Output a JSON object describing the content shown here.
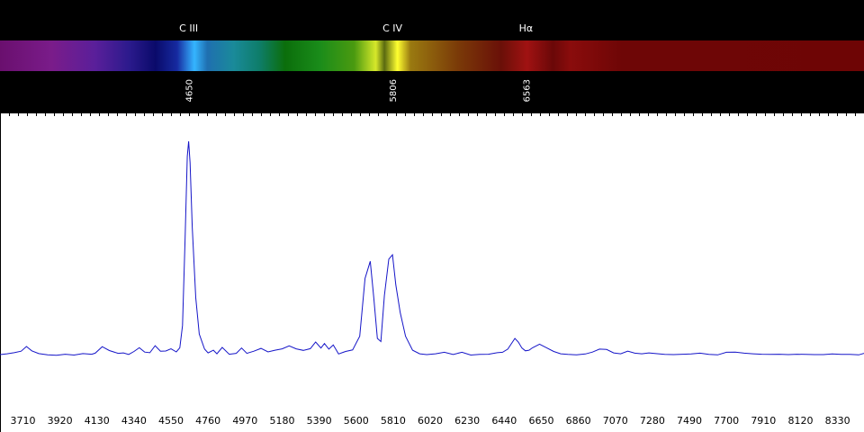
{
  "chart_data": {
    "type": "line",
    "xlabel": "",
    "ylabel": "",
    "xlim": [
      3580,
      8480
    ],
    "ylim": [
      0,
      100
    ],
    "x_ticks": [
      3710,
      3920,
      4130,
      4340,
      4550,
      4760,
      4970,
      5180,
      5390,
      5600,
      5810,
      6020,
      6230,
      6440,
      6650,
      6860,
      7070,
      7280,
      7490,
      7700,
      7910,
      8120,
      8330
    ],
    "line_color": "#1515c8",
    "lines": [
      {
        "name": "C III",
        "wavelength": "4650"
      },
      {
        "name": "C IV",
        "wavelength": "5806"
      },
      {
        "name": "Hα",
        "wavelength": "6563"
      }
    ],
    "series": [
      {
        "x": [
          3580,
          3620,
          3660,
          3700,
          3730,
          3760,
          3800,
          3850,
          3900,
          3950,
          4000,
          4050,
          4100,
          4120,
          4160,
          4200,
          4250,
          4280,
          4310,
          4340,
          4370,
          4400,
          4430,
          4460,
          4490,
          4520,
          4550,
          4580,
          4600,
          4615,
          4630,
          4642,
          4650,
          4658,
          4670,
          4690,
          4710,
          4740,
          4760,
          4790,
          4810,
          4840,
          4880,
          4920,
          4950,
          4980,
          5020,
          5060,
          5100,
          5140,
          5180,
          5220,
          5260,
          5300,
          5340,
          5370,
          5400,
          5420,
          5445,
          5470,
          5500,
          5540,
          5580,
          5620,
          5650,
          5680,
          5700,
          5720,
          5740,
          5760,
          5785,
          5806,
          5825,
          5850,
          5880,
          5920,
          5960,
          6000,
          6050,
          6100,
          6150,
          6200,
          6250,
          6300,
          6350,
          6400,
          6430,
          6460,
          6480,
          6500,
          6520,
          6540,
          6560,
          6580,
          6600,
          6640,
          6680,
          6720,
          6760,
          6800,
          6850,
          6900,
          6940,
          6980,
          7020,
          7060,
          7100,
          7140,
          7180,
          7220,
          7260,
          7300,
          7350,
          7400,
          7450,
          7500,
          7550,
          7600,
          7650,
          7700,
          7750,
          7800,
          7850,
          7900,
          7950,
          8000,
          8050,
          8100,
          8150,
          8200,
          8250,
          8300,
          8350,
          8400,
          8450,
          8480
        ],
        "y": [
          0.4,
          0.8,
          1.3,
          2.0,
          4.2,
          2.2,
          0.9,
          0.3,
          0.1,
          0.6,
          0.2,
          0.9,
          0.6,
          1.1,
          4.1,
          2.3,
          1.0,
          1.2,
          0.5,
          1.9,
          3.6,
          1.6,
          1.3,
          4.6,
          2.0,
          2.1,
          3.1,
          1.7,
          3.6,
          14.0,
          55.0,
          93.0,
          100.0,
          90.0,
          60.0,
          27.0,
          10.0,
          3.0,
          1.2,
          2.5,
          0.8,
          3.8,
          0.6,
          1.0,
          3.5,
          1.0,
          2.0,
          3.3,
          1.7,
          2.5,
          3.1,
          4.5,
          3.1,
          2.4,
          3.2,
          6.3,
          3.5,
          5.6,
          3.0,
          4.9,
          0.7,
          1.9,
          2.6,
          9.0,
          36.0,
          44.0,
          27.0,
          8.0,
          6.5,
          28.0,
          45.0,
          47.0,
          33.0,
          20.0,
          9.0,
          2.5,
          0.8,
          0.4,
          0.8,
          1.5,
          0.5,
          1.5,
          0.2,
          0.5,
          0.6,
          1.3,
          1.5,
          3.0,
          5.5,
          8.0,
          6.2,
          3.5,
          2.2,
          2.5,
          3.6,
          5.3,
          3.6,
          1.9,
          0.8,
          0.5,
          0.3,
          0.7,
          1.6,
          3.0,
          2.8,
          1.2,
          0.8,
          2.0,
          1.1,
          0.8,
          1.2,
          0.9,
          0.5,
          0.4,
          0.6,
          0.7,
          1.1,
          0.5,
          0.3,
          1.5,
          1.6,
          1.1,
          0.8,
          0.6,
          0.5,
          0.6,
          0.4,
          0.6,
          0.5,
          0.4,
          0.4,
          0.7,
          0.5,
          0.5,
          0.3,
          1.0
        ]
      }
    ]
  },
  "colors": {
    "background_top": "#000000",
    "plot_background": "#ffffff",
    "tick_label": "#000000",
    "header_label": "#ffffff"
  }
}
